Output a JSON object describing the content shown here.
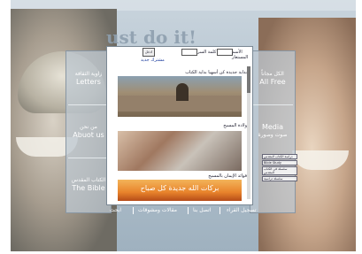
{
  "tagline": "ust do it!",
  "left_nav": [
    {
      "ar": "زاوية الثقافة",
      "en": "Letters"
    },
    {
      "ar": "من نحن",
      "en": "Abuot us"
    },
    {
      "ar": "الكتاب المقدس",
      "en": "The Bible"
    }
  ],
  "right_nav": [
    {
      "ar": "الكل مجاناً",
      "en": "All Free"
    },
    {
      "ar": "صوت وصورة",
      "en": "Media"
    }
  ],
  "login": {
    "user_label": "الأسم المستعار",
    "pass_label": "كلمة السر",
    "go_label": "ادخل",
    "register_link": "مشترك جديد"
  },
  "content": {
    "section1_caption": "بداية جديدة كن أسهيا بداية الكتاب",
    "section2_caption": "ولادة المسيح",
    "section3_caption": "فوائد الإيمان بالمسيح",
    "banner_text": "بركات الله جديدة كل صباح"
  },
  "mini_links": [
    "دراسة الكتاب المقدس",
    "Bible Study",
    "سلسلة في الكتاب المقدس",
    "سلسلة دراسية"
  ],
  "bottom_nav": [
    "تسجيل القراء",
    "اتصل بنا",
    "مقالات ومشوقات",
    "ابحث"
  ]
}
